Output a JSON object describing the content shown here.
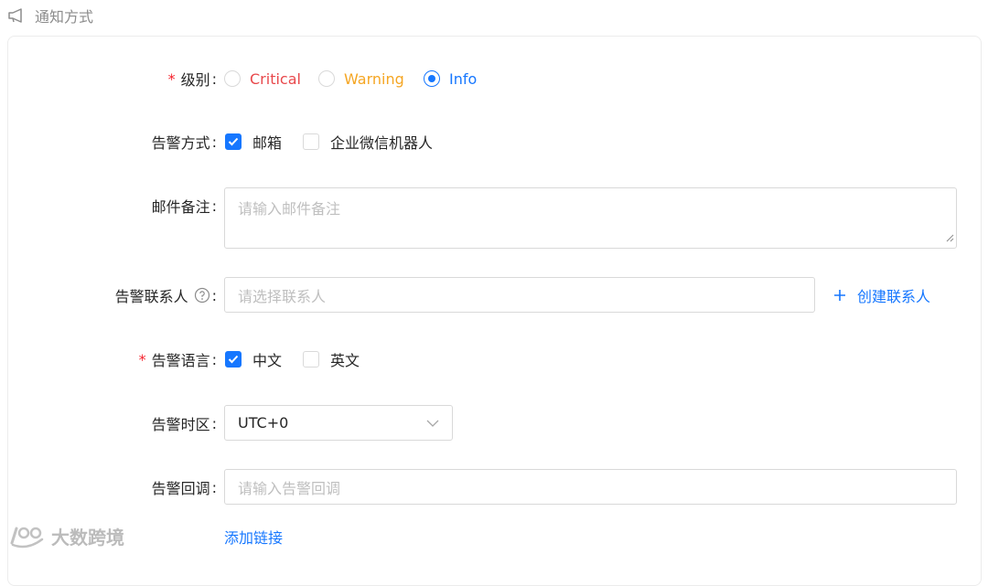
{
  "section": {
    "title": "通知方式",
    "icon": "megaphone-icon"
  },
  "form": {
    "level": {
      "label": "级别",
      "required_mark": "*",
      "colon": ":",
      "options": [
        {
          "label": "Critical",
          "color": "#e8484b",
          "selected": false
        },
        {
          "label": "Warning",
          "color": "#f5a623",
          "selected": false
        },
        {
          "label": "Info",
          "color": "#1677ff",
          "selected": true
        }
      ]
    },
    "method": {
      "label": "告警方式",
      "colon": ":",
      "options": [
        {
          "label": "邮箱",
          "checked": true
        },
        {
          "label": "企业微信机器人",
          "checked": false
        }
      ]
    },
    "email_note": {
      "label": "邮件备注",
      "colon": ":",
      "placeholder": "请输入邮件备注",
      "value": ""
    },
    "contact": {
      "label": "告警联系人",
      "colon": ":",
      "placeholder": "请选择联系人",
      "value": "",
      "create_link": "创建联系人",
      "help_icon": "question-circle-icon"
    },
    "language": {
      "label": "告警语言",
      "required_mark": "*",
      "colon": ":",
      "options": [
        {
          "label": "中文",
          "checked": true
        },
        {
          "label": "英文",
          "checked": false
        }
      ]
    },
    "timezone": {
      "label": "告警时区",
      "colon": ":",
      "value": "UTC+0"
    },
    "callback": {
      "label": "告警回调",
      "colon": ":",
      "placeholder": "请输入告警回调",
      "value": ""
    },
    "add_link": "添加链接"
  },
  "watermark": {
    "text": "大数跨境"
  },
  "colors": {
    "accent": "#1677ff",
    "required": "#f5222d",
    "border": "#d9d9d9"
  }
}
